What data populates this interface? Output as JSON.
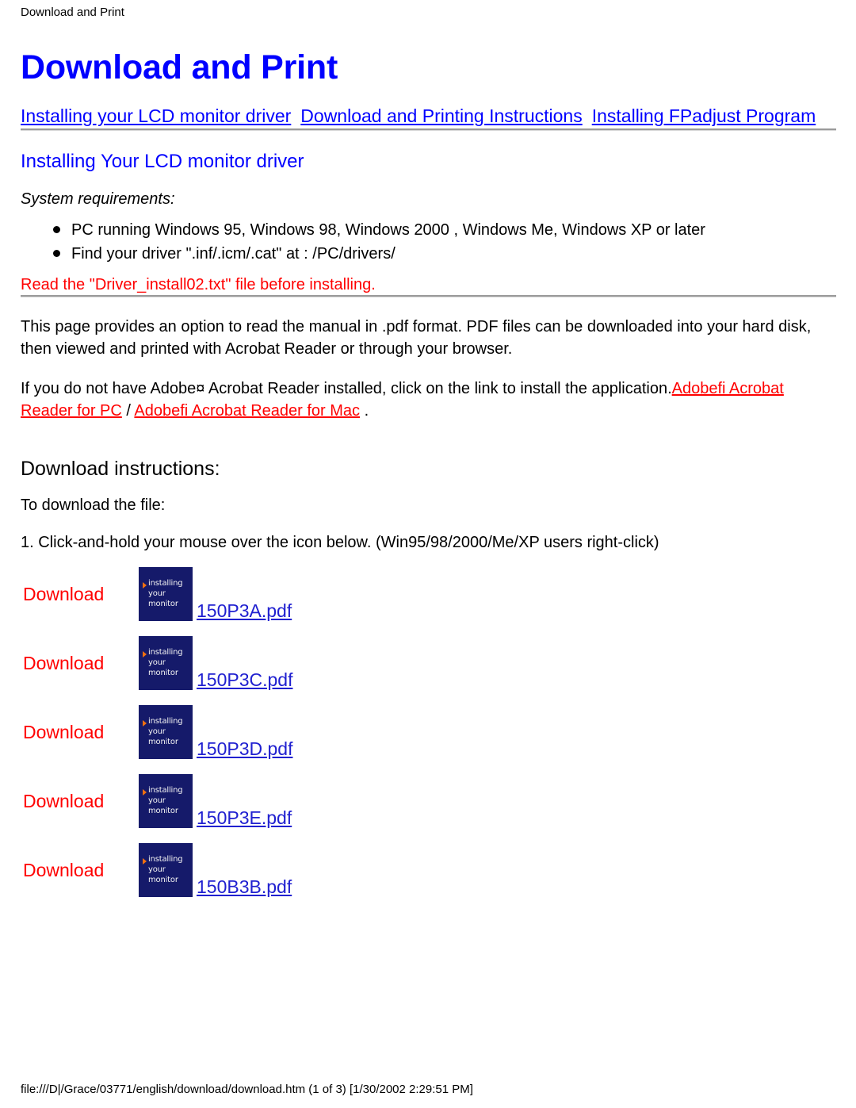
{
  "document": {
    "running_header": "Download and Print",
    "title": "Download and Print"
  },
  "nav": {
    "links": [
      {
        "label": "Installing your LCD monitor driver"
      },
      {
        "label": "Download and Printing Instructions"
      },
      {
        "label": "Installing FPadjust Program"
      }
    ]
  },
  "driver_section": {
    "heading": "Installing Your LCD monitor driver",
    "sysreq_label": "System requirements:",
    "requirements": [
      "PC running Windows 95, Windows 98, Windows 2000 , Windows Me, Windows XP or later",
      "Find your driver \".inf/.icm/.cat\" at : /PC/drivers/"
    ],
    "warning": "Read the \"Driver_install02.txt\" file before installing."
  },
  "pdf_section": {
    "paragraph1": "This page provides an option to read the manual in .pdf format. PDF files can be downloaded into your hard disk, then viewed and printed with Acrobat Reader or through your browser.",
    "paragraph2_prefix": "If you do not have Adobe¤ Acrobat Reader installed, click on the link to install the application.",
    "link_pc": "Adobefi Acrobat Reader for PC",
    "separator": " / ",
    "link_mac": "Adobefi Acrobat Reader for Mac",
    "paragraph2_suffix": " ."
  },
  "download_section": {
    "heading": "Download instructions:",
    "intro": "To download the file:",
    "step1": "1. Click-and-hold your mouse over the icon below. (Win95/98/2000/Me/XP users right-click)",
    "icon_text_line1": "installing your",
    "icon_text_line2": "monitor",
    "rows": [
      {
        "label": "Download",
        "file": "150P3A.pdf"
      },
      {
        "label": "Download",
        "file": "150P3C.pdf"
      },
      {
        "label": "Download",
        "file": "150P3D.pdf"
      },
      {
        "label": "Download",
        "file": "150P3E.pdf"
      },
      {
        "label": "Download",
        "file": "150B3B.pdf"
      }
    ]
  },
  "footer": {
    "status": "file:///D|/Grace/03771/english/download/download.htm (1 of 3) [1/30/2002 2:29:51 PM]"
  },
  "colors": {
    "heading_blue": "#0000ff",
    "link_blue": "#0000ff",
    "warning_red": "#ff0000",
    "icon_navy": "#151a6a",
    "icon_arrow_orange": "#f07010",
    "pdf_link_blue": "#2020d0"
  }
}
